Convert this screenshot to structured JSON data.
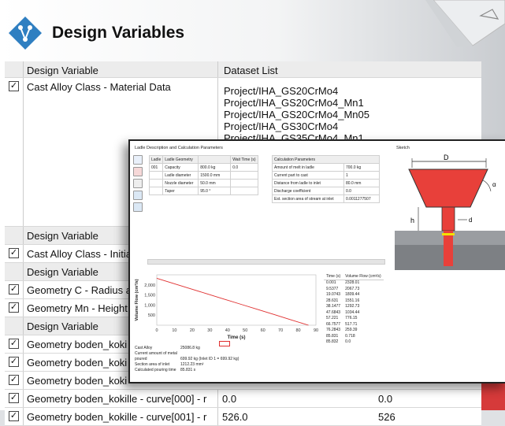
{
  "header": {
    "title": "Design Variables"
  },
  "table": {
    "col_variable": "Design Variable",
    "col_dataset": "Dataset List",
    "first_row": {
      "label": "Cast Alloy Class - Material Data",
      "datasets": [
        "Project/IHA_GS20CrMo4",
        "Project/IHA_GS20CrMo4_Mn1",
        "Project/IHA_GS20CrMo4_Mn05",
        "Project/IHA_GS30CrMo4",
        "Project/IHA_GS35CrMo4_Mn1"
      ]
    },
    "rows": [
      {
        "kind": "head",
        "label": "Design Variable"
      },
      {
        "kind": "item",
        "label": "Cast Alloy Class - Initia",
        "checked": "✓"
      },
      {
        "kind": "head",
        "label": "Design Variable"
      },
      {
        "kind": "item",
        "label": "Geometry C - Radius a",
        "checked": "✓"
      },
      {
        "kind": "item",
        "label": "Geometry Mn - Height",
        "checked": "✓"
      },
      {
        "kind": "head",
        "label": "Design Variable"
      },
      {
        "kind": "item",
        "label": "Geometry boden_koki",
        "checked": "✓"
      },
      {
        "kind": "item",
        "label": "Geometry boden_koki",
        "checked": "✓"
      },
      {
        "kind": "item",
        "label": "Geometry boden_koki",
        "checked": "✓"
      },
      {
        "kind": "item",
        "label": "Geometry boden_kokille - curve[000] - r",
        "checked": "✓",
        "v1": "0.0",
        "v2": "0.0"
      },
      {
        "kind": "item",
        "label": "Geometry boden_kokille - curve[001] - r",
        "checked": "✓",
        "v1": "526.0",
        "v2": "526"
      }
    ]
  },
  "overlay": {
    "section_title": "Ladle Description and Calculation Parameters",
    "sketch_title": "Sketch",
    "ladle_headers": [
      "Ladle",
      "Ladle Geometry",
      "",
      "Wait Time (s)"
    ],
    "ladle_rows": [
      [
        "001",
        "Capacity",
        "800.0 kg",
        "0.0"
      ],
      [
        "",
        "Ladle diameter",
        "1500.0 mm",
        ""
      ],
      [
        "",
        "Nozzle diameter",
        "50.0 mm",
        ""
      ],
      [
        "",
        "Taper",
        "95.0 °",
        ""
      ]
    ],
    "calc_header": "Calculation Parameters",
    "calc_rows": [
      [
        "Amount of melt in ladle",
        "700.0 kg"
      ],
      [
        "Current part to cast",
        "1"
      ],
      [
        "Distance from ladle to inlet",
        "80.0 mm"
      ],
      [
        "Discharge coefficient",
        "0.0"
      ],
      [
        "Est. section area of stream at inlet",
        "0.0011277507"
      ]
    ],
    "sketch_labels": {
      "D": "D",
      "d": "d",
      "h": "h",
      "alpha": "α"
    },
    "chart_data": {
      "type": "line",
      "xlabel": "Time (s)",
      "ylabel": "Volume Flow (cm³/s)",
      "x_ticks": [
        "0",
        "10",
        "20",
        "30",
        "40",
        "50",
        "60",
        "70",
        "80",
        "90"
      ],
      "y_ticks": [
        "2,000",
        "1,500",
        "1,000",
        "500"
      ],
      "xlim": [
        0,
        90
      ],
      "ylim": [
        0,
        2500
      ],
      "series": [
        {
          "values_x": [
            0.001,
            9.5377,
            19.0743,
            28.631,
            38.1477,
            47.6843,
            57.221,
            66.7577,
            76.2843,
            85.831,
            85.832
          ],
          "values_y": [
            2328.01,
            2067.73,
            1809.44,
            1551.16,
            1292.73,
            1034.44,
            776.15,
            517.71,
            259.39,
            0.718,
            0.0
          ]
        }
      ],
      "legend_box": ""
    },
    "info": [
      [
        "Cast Alloy",
        "25086.8 kg"
      ],
      [
        "Current amount of metal poured",
        "699.92 kg (Inlet ID 1 = 699.92 kg)"
      ],
      [
        "Section area of inlet",
        "1212.23 mm²"
      ],
      [
        "Calculated pouring time",
        "85.831 s"
      ]
    ],
    "time_table": {
      "headers": [
        "Time (s)",
        "Volume Flow (cm³/s)"
      ],
      "rows": [
        [
          "0.001",
          "2328.01"
        ],
        [
          "9.5377",
          "2067.73"
        ],
        [
          "19.0743",
          "1809.44"
        ],
        [
          "28.631",
          "1551.16"
        ],
        [
          "38.1477",
          "1292.73"
        ],
        [
          "47.6843",
          "1034.44"
        ],
        [
          "57.221",
          "776.15"
        ],
        [
          "66.7577",
          "517.71"
        ],
        [
          "76.2843",
          "259.39"
        ],
        [
          "85.831",
          "0.718"
        ],
        [
          "85.832",
          "0.0"
        ]
      ]
    }
  },
  "colors": {
    "accent_blue": "#2f7fc1",
    "red": "#e03030",
    "ladle_red": "#e8403a"
  }
}
